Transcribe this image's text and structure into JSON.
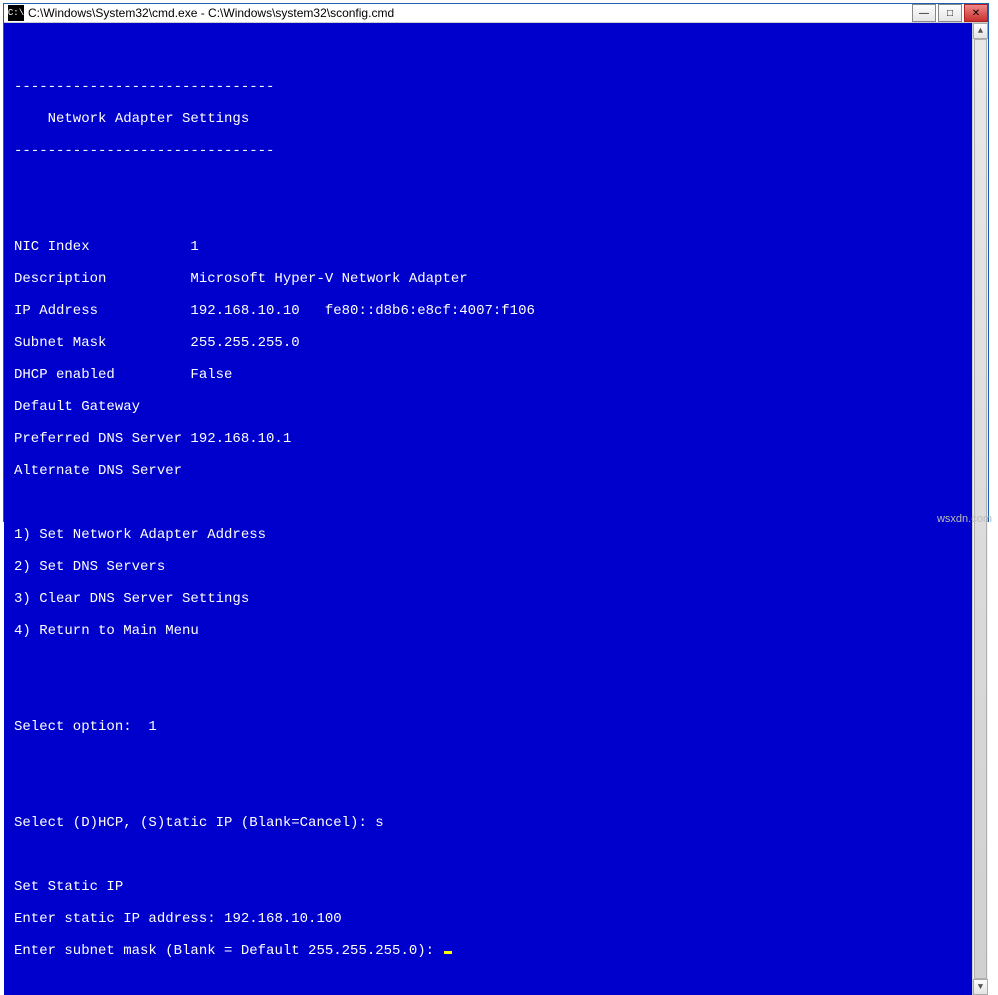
{
  "window": {
    "title": "C:\\Windows\\System32\\cmd.exe - C:\\Windows\\system32\\sconfig.cmd",
    "icon_glyph": "C:\\"
  },
  "section": {
    "rule": "-------------------------------",
    "title": "    Network Adapter Settings"
  },
  "fields": {
    "nic_index_label": "NIC Index",
    "nic_index_value": "1",
    "description_label": "Description",
    "description_value": "Microsoft Hyper-V Network Adapter",
    "ip_label": "IP Address",
    "ip_value": "192.168.10.10   fe80::d8b6:e8cf:4007:f106",
    "subnet_label": "Subnet Mask",
    "subnet_value": "255.255.255.0",
    "dhcp_label": "DHCP enabled",
    "dhcp_value": "False",
    "gateway_label": "Default Gateway",
    "gateway_value": "",
    "pdns_label": "Preferred DNS Server",
    "pdns_value": "192.168.10.1",
    "adns_label": "Alternate DNS Server",
    "adns_value": ""
  },
  "menu": {
    "opt1": "1) Set Network Adapter Address",
    "opt2": "2) Set DNS Servers",
    "opt3": "3) Clear DNS Server Settings",
    "opt4": "4) Return to Main Menu"
  },
  "prompts": {
    "select_option_label": "Select option:  ",
    "select_option_value": "1",
    "dhcp_static_label": "Select (D)HCP, (S)tatic IP (Blank=Cancel): ",
    "dhcp_static_value": "s",
    "set_static_header": "Set Static IP",
    "enter_ip_label": "Enter static IP address: ",
    "enter_ip_value": "192.168.10.100",
    "enter_subnet_label": "Enter subnet mask (Blank = Default 255.255.255.0): "
  },
  "watermark": "wsxdn.com"
}
